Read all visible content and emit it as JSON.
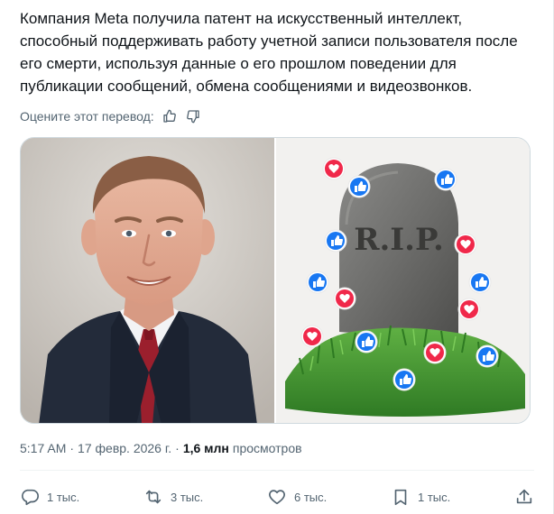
{
  "tweet": {
    "text": "Компания Meta получила патент на искусственный интеллект, способный поддерживать работу учетной записи пользователя после его смерти, используя данные о его прошлом поведении для публикации сообщений, обмена сообщениями и видеозвонков."
  },
  "translation_rating": {
    "label": "Оцените этот перевод:"
  },
  "media": {
    "tombstone_text": "R.I.P."
  },
  "meta": {
    "time": "5:17 AM",
    "separator": "·",
    "date": "17 февр. 2026 г.",
    "separator2": "·",
    "views_count": "1,6 млн",
    "views_label": "просмотров"
  },
  "actions": {
    "replies": "1 тыс.",
    "reposts": "3 тыс.",
    "likes": "6 тыс.",
    "bookmarks": "1 тыс."
  },
  "colors": {
    "text_primary": "#0f1419",
    "text_secondary": "#536471",
    "fb_blue": "#1877f2",
    "heart_red": "#f0284a",
    "grass": "#3f8f2e"
  }
}
